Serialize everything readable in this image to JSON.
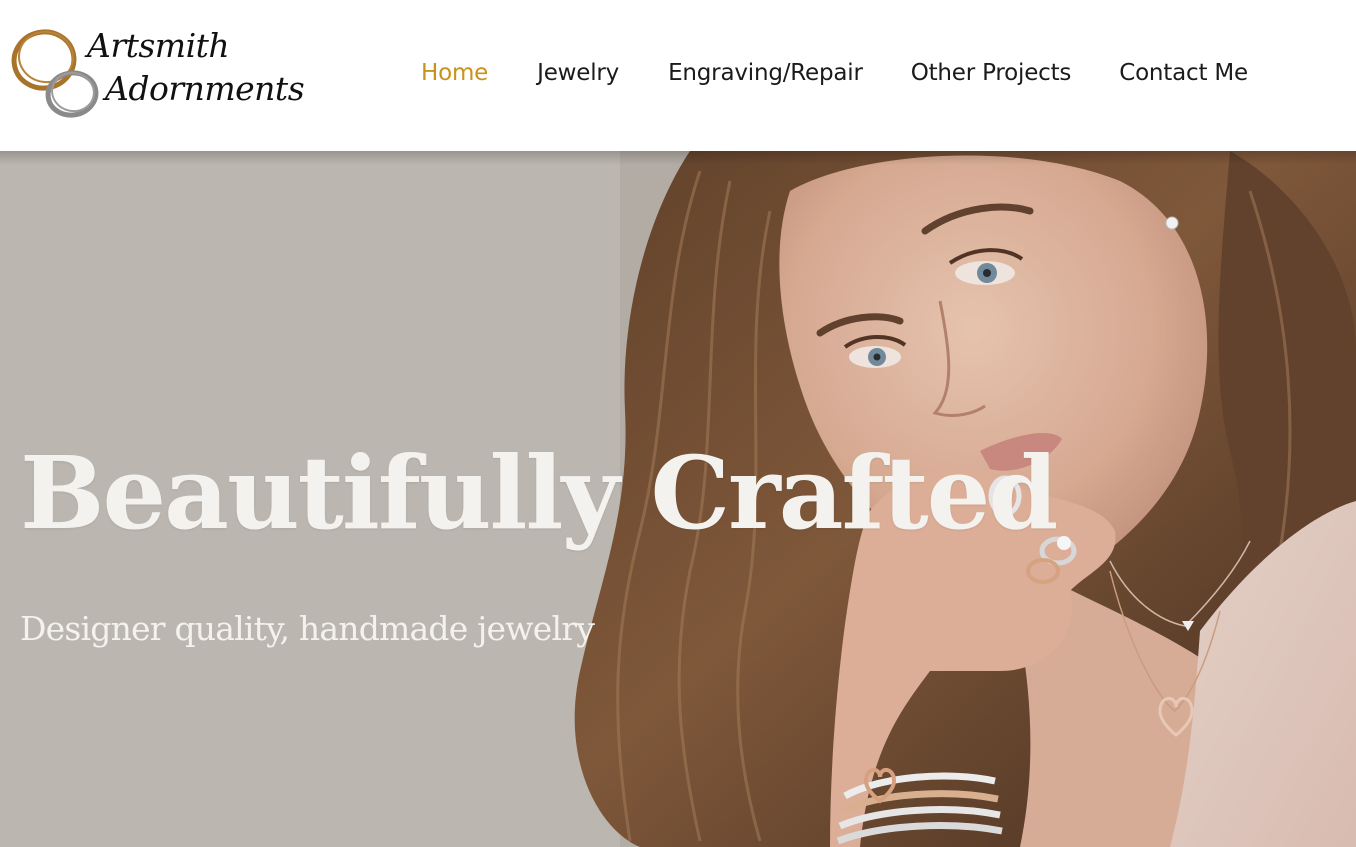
{
  "brand": {
    "line1": "Artsmith",
    "line2": "Adornments",
    "ring_colors": [
      "#a8732a",
      "#8a8a8a"
    ]
  },
  "nav": {
    "items": [
      {
        "label": "Home",
        "active": true
      },
      {
        "label": "Jewelry",
        "active": false
      },
      {
        "label": "Engraving/Repair",
        "active": false
      },
      {
        "label": "Other Projects",
        "active": false
      },
      {
        "label": "Contact Me",
        "active": false
      }
    ],
    "active_color": "#c9921e"
  },
  "hero": {
    "title": "Beautifully Crafted",
    "subtitle": "Designer quality, handmade jewelry",
    "image": "model-with-jewelry-photo"
  }
}
